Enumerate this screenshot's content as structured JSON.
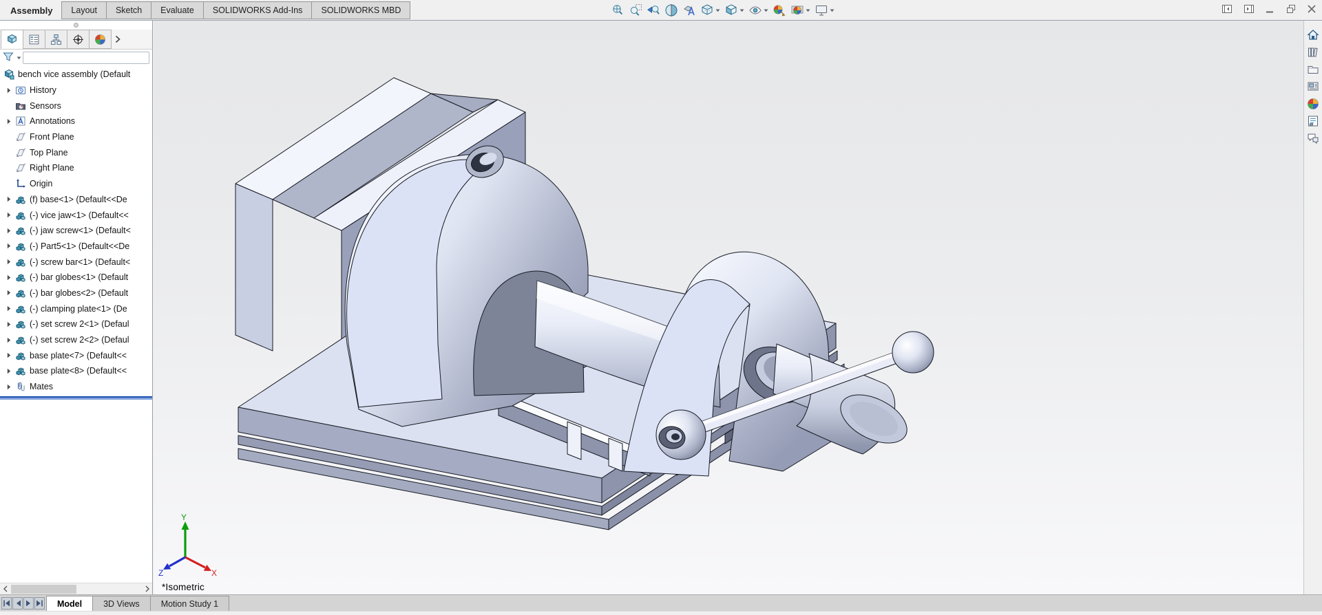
{
  "command_tabs": {
    "items": [
      {
        "label": "Assembly",
        "active": true
      },
      {
        "label": "Layout",
        "active": false
      },
      {
        "label": "Sketch",
        "active": false
      },
      {
        "label": "Evaluate",
        "active": false
      },
      {
        "label": "SOLIDWORKS Add-Ins",
        "active": false
      },
      {
        "label": "SOLIDWORKS MBD",
        "active": false
      }
    ]
  },
  "headsup_toolbar": {
    "buttons": [
      {
        "icon": "zoom-fit",
        "caret": false
      },
      {
        "icon": "zoom-area",
        "caret": false
      },
      {
        "icon": "previous-view",
        "caret": false
      },
      {
        "icon": "section-view",
        "caret": false
      },
      {
        "icon": "hide-show-annotations",
        "caret": false
      },
      {
        "icon": "view-orientation",
        "caret": true
      },
      {
        "icon": "display-style",
        "caret": true
      },
      {
        "icon": "hide-show-items",
        "caret": true
      },
      {
        "icon": "edit-appearance",
        "caret": false
      },
      {
        "icon": "apply-scene",
        "caret": true
      },
      {
        "icon": "view-settings",
        "caret": true
      }
    ]
  },
  "window_controls": {
    "buttons": [
      "collapse-panel-left",
      "collapse-panel-right",
      "minimize",
      "restore",
      "close"
    ]
  },
  "feature_panel": {
    "tabs": [
      {
        "icon": "featuremanager",
        "active": true
      },
      {
        "icon": "propertymanager",
        "active": false
      },
      {
        "icon": "configurationmanager",
        "active": false
      },
      {
        "icon": "dimxpertmanager",
        "active": false
      },
      {
        "icon": "displaymanager",
        "active": false
      }
    ],
    "overflow_icon": "chevron-right",
    "filter": {
      "icon": "filter-funnel",
      "value": "",
      "placeholder": ""
    },
    "tree": [
      {
        "label": "bench vice assembly (Default",
        "icon": "assembly",
        "expander": false,
        "level": 0
      },
      {
        "label": "History",
        "icon": "history",
        "expander": true,
        "level": 1
      },
      {
        "label": "Sensors",
        "icon": "sensors",
        "expander": false,
        "level": 1
      },
      {
        "label": "Annotations",
        "icon": "annotations",
        "expander": true,
        "level": 1
      },
      {
        "label": "Front Plane",
        "icon": "plane",
        "expander": false,
        "level": 1
      },
      {
        "label": "Top Plane",
        "icon": "plane",
        "expander": false,
        "level": 1
      },
      {
        "label": "Right Plane",
        "icon": "plane",
        "expander": false,
        "level": 1
      },
      {
        "label": "Origin",
        "icon": "origin",
        "expander": false,
        "level": 1
      },
      {
        "label": "(f) base<1> (Default<<De",
        "icon": "part",
        "expander": true,
        "level": 1
      },
      {
        "label": "(-) vice jaw<1> (Default<<",
        "icon": "part",
        "expander": true,
        "level": 1
      },
      {
        "label": "(-) jaw screw<1> (Default<",
        "icon": "part",
        "expander": true,
        "level": 1
      },
      {
        "label": "(-) Part5<1> (Default<<De",
        "icon": "part",
        "expander": true,
        "level": 1
      },
      {
        "label": "(-) screw bar<1> (Default<",
        "icon": "part",
        "expander": true,
        "level": 1
      },
      {
        "label": "(-) bar globes<1> (Default",
        "icon": "part",
        "expander": true,
        "level": 1
      },
      {
        "label": "(-) bar globes<2> (Default",
        "icon": "part",
        "expander": true,
        "level": 1
      },
      {
        "label": "(-) clamping plate<1> (De",
        "icon": "part",
        "expander": true,
        "level": 1
      },
      {
        "label": "(-) set screw 2<1> (Defaul",
        "icon": "part",
        "expander": true,
        "level": 1
      },
      {
        "label": "(-) set screw 2<2> (Defaul",
        "icon": "part",
        "expander": true,
        "level": 1
      },
      {
        "label": "base plate<7> (Default<<",
        "icon": "part",
        "expander": true,
        "level": 1
      },
      {
        "label": "base plate<8> (Default<<",
        "icon": "part",
        "expander": true,
        "level": 1
      },
      {
        "label": "Mates",
        "icon": "mates",
        "expander": true,
        "level": 1
      }
    ]
  },
  "viewport": {
    "view_label": "*Isometric",
    "triad": {
      "x_label": "X",
      "y_label": "Y",
      "z_label": "Z"
    }
  },
  "task_pane": {
    "items": [
      "home",
      "design-library",
      "file-explorer",
      "view-palette",
      "appearances",
      "custom-properties",
      "forum"
    ]
  },
  "motion_bar": {
    "nav": [
      "first",
      "prev",
      "next",
      "last"
    ],
    "tabs": [
      {
        "label": "Model",
        "active": true
      },
      {
        "label": "3D Views",
        "active": false
      },
      {
        "label": "Motion Study 1",
        "active": false
      }
    ]
  },
  "colors": {
    "rollback_blue": "#1c51b0",
    "model_face_light": "#dce2f6",
    "model_face_mid": "#9ba2bb",
    "model_face_top": "#f3f5fc",
    "viewport_top": "#e6e7e9",
    "viewport_bottom": "#f8f8fa",
    "triad_x": "#d42020",
    "triad_y": "#0b9e0b",
    "triad_z": "#2330c8"
  }
}
